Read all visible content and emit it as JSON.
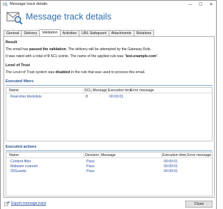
{
  "window": {
    "title": "Message track details",
    "controls": {
      "minimize": "—",
      "maximize": "☐",
      "close": "✕"
    }
  },
  "header": {
    "title": "Message track details"
  },
  "tabs": [
    {
      "label": "General",
      "active": false
    },
    {
      "label": "Delivery",
      "active": false
    },
    {
      "label": "Validation",
      "active": true
    },
    {
      "label": "Activities",
      "active": false
    },
    {
      "label": "URL Safeguard",
      "active": false
    },
    {
      "label": "Attachments",
      "active": false
    },
    {
      "label": "Relations",
      "active": false
    }
  ],
  "result": {
    "heading": "Result",
    "line1_pre": "The email has ",
    "line1_bold": "passed the validation",
    "line1_post": ". The delivery will be attempted by the Gateway Role.",
    "line2_pre": "It was rated with a total of ",
    "line2_points": "0",
    "line2_mid": " SCL points. The name of the applied rule was \"",
    "line2_rule": "test.example.com",
    "line2_post": "\"."
  },
  "trust": {
    "heading": "Level of Trust",
    "line_pre": "The Level of Trust system was ",
    "line_bold": "disabled",
    "line_post": " in the rule that was used to process this email."
  },
  "executed_filters": {
    "title": "Executed filters",
    "columns": [
      "Name",
      "SCL",
      "Message",
      "Execution time",
      "Error message"
    ],
    "rows": [
      {
        "name": "Real-time blocklists",
        "scl": "0",
        "message": "",
        "time": "00:00:01",
        "error": ""
      }
    ]
  },
  "executed_actions": {
    "title": "Executed actions",
    "columns": [
      "Name",
      "Decision",
      "Message",
      "Execution time",
      "Error message"
    ],
    "rows": [
      {
        "name": "Content filter",
        "decision": "Pass",
        "message": "",
        "time": "00:00:01",
        "error": ""
      },
      {
        "name": "Malware scanner",
        "decision": "Pass",
        "message": "",
        "time": "00:00:01",
        "error": ""
      },
      {
        "name": "32Guards",
        "decision": "Pass",
        "message": "",
        "time": "00:00:01",
        "error": ""
      }
    ]
  },
  "footer": {
    "export_label": "Export message track",
    "close_label": "Close"
  },
  "colors": {
    "accent_blue": "#2d6aa8",
    "link_blue": "#2a4f9e",
    "group_title": "#1e4e8c"
  },
  "icons": {
    "app": "envelope-magnifier-icon",
    "header": "envelope-magnifier-icon",
    "export": "export-icon"
  }
}
